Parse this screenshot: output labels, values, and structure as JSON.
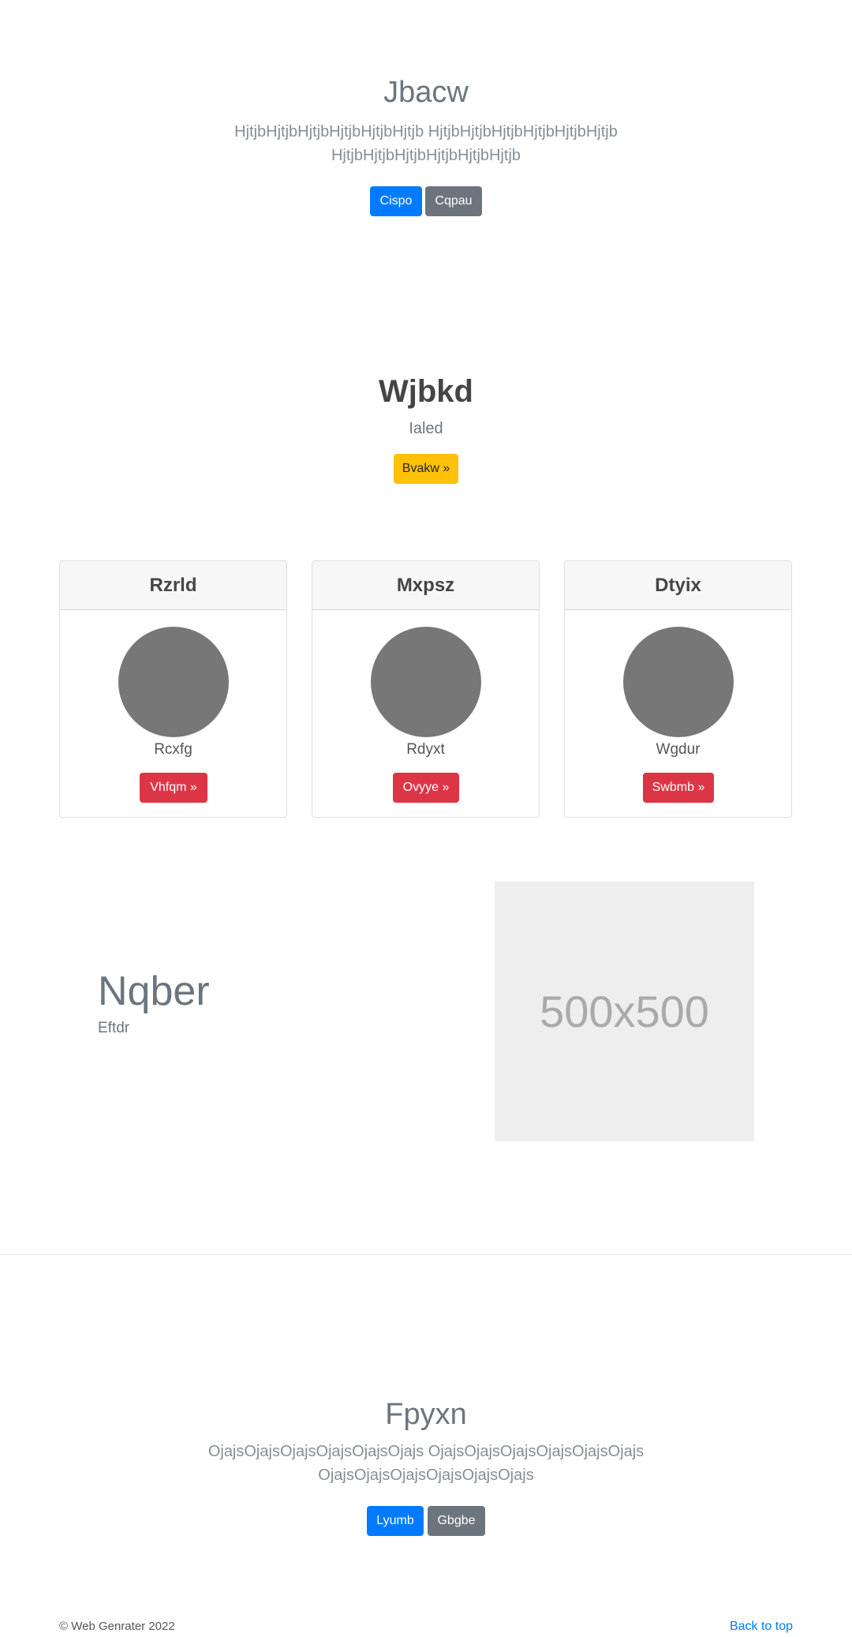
{
  "hero1": {
    "title": "Jbacw",
    "lead_line1": "HjtjbHjtjbHjtjbHjtjbHjtjbHjtjb HjtjbHjtjbHjtjbHjtjbHjtjbHjtjb",
    "lead_line2": "HjtjbHjtjbHjtjbHjtjbHjtjbHjtjb",
    "primary_button": "Cispo",
    "secondary_button": "Cqpau"
  },
  "feature": {
    "title": "Wjbkd",
    "subtitle": "Ialed",
    "button": "Bvakw »"
  },
  "cards": [
    {
      "header": "Rzrld",
      "text": "Rcxfg",
      "button": "Vhfqm »"
    },
    {
      "header": "Mxpsz",
      "text": "Rdyxt",
      "button": "Ovyye »"
    },
    {
      "header": "Dtyix",
      "text": "Wgdur",
      "button": "Swbmb »"
    }
  ],
  "split": {
    "title": "Nqber",
    "subtitle": "Eftdr",
    "image_label": "500x500"
  },
  "hero2": {
    "title": "Fpyxn",
    "lead_line1": "OjajsOjajsOjajsOjajsOjajsOjajs OjajsOjajsOjajsOjajsOjajsOjajs",
    "lead_line2": "OjajsOjajsOjajsOjajsOjajsOjajs",
    "primary_button": "Lyumb",
    "secondary_button": "Gbgbe"
  },
  "footer": {
    "copyright": "© Web Genrater 2022",
    "back_to_top": "Back to top"
  },
  "colors": {
    "primary": "#007bff",
    "secondary": "#6c757d",
    "warning": "#ffc107",
    "danger": "#dc3545",
    "avatar_gray": "#777777"
  }
}
